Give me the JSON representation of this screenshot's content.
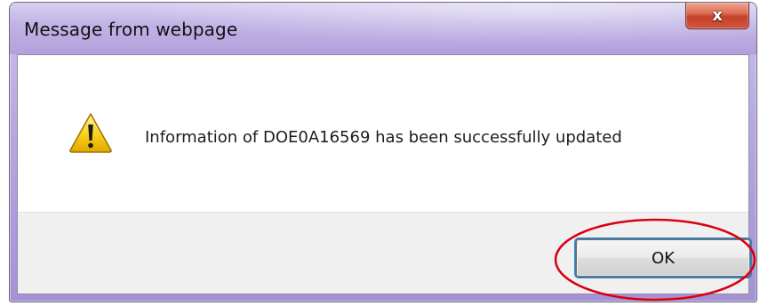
{
  "dialog": {
    "title": "Message from webpage",
    "close_glyph": "x",
    "message": "Information of DOE0A16569 has been successfully updated",
    "icon": "warning-icon",
    "ok_label": "OK"
  },
  "colors": {
    "frame": "#b9a9e0",
    "close_button": "#c4402a",
    "footer": "#f0f0f0",
    "ok_focus_ring": "#3c7fb1",
    "highlight": "#d9000f",
    "warning_fill": "#f7d118"
  }
}
